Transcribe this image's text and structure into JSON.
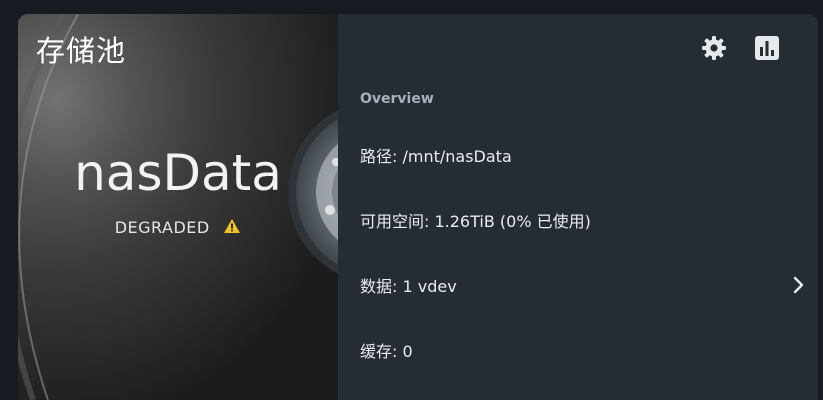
{
  "header": {
    "title": "存储池",
    "settings_icon": "gear-icon",
    "stats_icon": "bar-chart-icon"
  },
  "pool": {
    "name": "nasData",
    "status": "DEGRADED",
    "status_icon": "warning-icon",
    "status_color": "#f2c12e"
  },
  "overview": {
    "section_label": "Overview",
    "rows": [
      {
        "text": "路径:  /mnt/nasData"
      },
      {
        "text": "可用空间: 1.26TiB  (0% 已使用)"
      },
      {
        "text": "数据:  1 vdev",
        "icon": "chevron-right-icon"
      },
      {
        "text": "缓存:  0"
      }
    ]
  },
  "colors": {
    "background": "#161b22",
    "panel": "#252c34",
    "text": "#e9ecef",
    "muted_label": "#a9b1bb"
  }
}
